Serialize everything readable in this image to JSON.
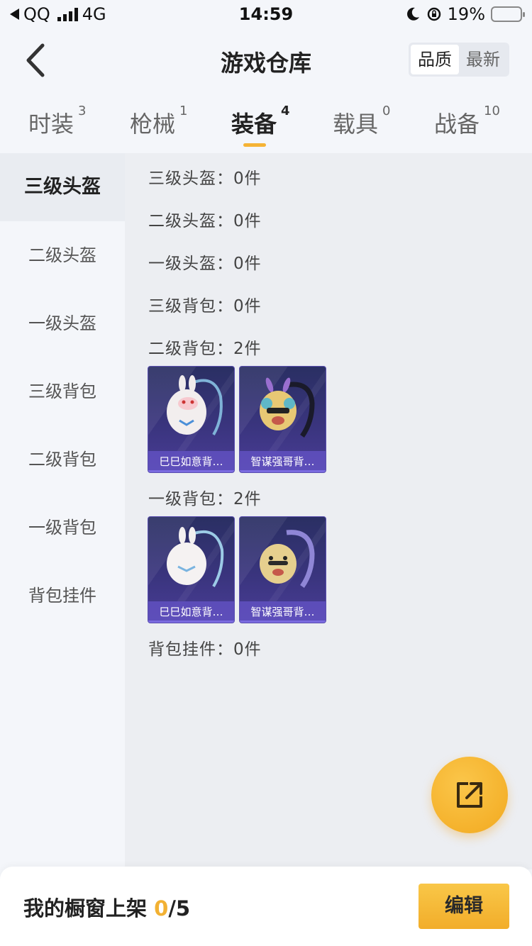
{
  "status_bar": {
    "carrier": "QQ",
    "network": "4G",
    "time": "14:59",
    "battery": "19%",
    "battery_color": "#e53935"
  },
  "header": {
    "title": "游戏仓库",
    "sort_options": [
      "品质",
      "最新"
    ],
    "sort_selected": "品质"
  },
  "tabs": [
    {
      "label": "时装",
      "count": "3"
    },
    {
      "label": "枪械",
      "count": "1"
    },
    {
      "label": "装备",
      "count": "4"
    },
    {
      "label": "载具",
      "count": "0"
    },
    {
      "label": "战备",
      "count": "10"
    }
  ],
  "active_tab": "装备",
  "sidebar": {
    "items": [
      "三级头盔",
      "二级头盔",
      "一级头盔",
      "三级背包",
      "二级背包",
      "一级背包",
      "背包挂件"
    ],
    "active": "三级头盔"
  },
  "content": {
    "categories": [
      {
        "label": "三级头盔：0件"
      },
      {
        "label": "二级头盔：0件"
      },
      {
        "label": "一级头盔：0件"
      },
      {
        "label": "三级背包：0件"
      },
      {
        "label": "二级背包：2件",
        "items": [
          "巳巳如意背…",
          "智谋强哥背…"
        ]
      },
      {
        "label": "一级背包：2件",
        "items": [
          "巳巳如意背…",
          "智谋强哥背…"
        ]
      },
      {
        "label": "背包挂件：0件"
      }
    ]
  },
  "bottom_bar": {
    "shelf_label": "我的橱窗上架",
    "shelf_current": "0",
    "shelf_total": "/5",
    "edit_label": "编辑"
  },
  "colors": {
    "accent": "#f5b335",
    "card_bg": "#3b3580"
  }
}
